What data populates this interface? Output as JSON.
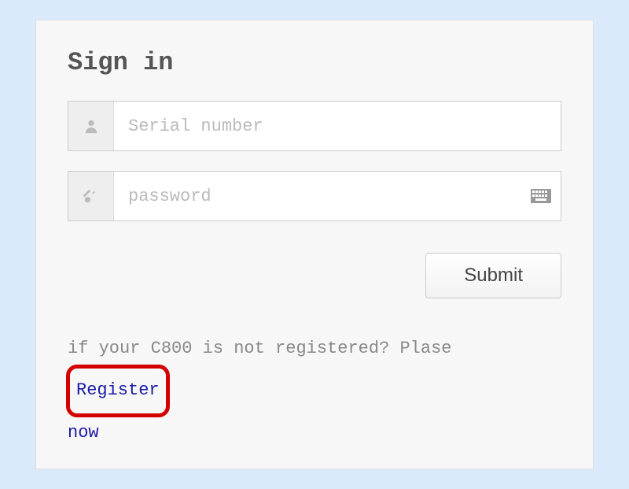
{
  "title": "Sign in",
  "serial": {
    "placeholder": "Serial number",
    "value": ""
  },
  "password": {
    "placeholder": "password",
    "value": ""
  },
  "submit": {
    "label": "Submit"
  },
  "register": {
    "prefix": "if your C800 is not registered? Plase ",
    "link_word1": "Register",
    "link_word2": "now"
  },
  "icons": {
    "user": "user-icon",
    "key": "key-icon",
    "keyboard": "keyboard-icon"
  }
}
